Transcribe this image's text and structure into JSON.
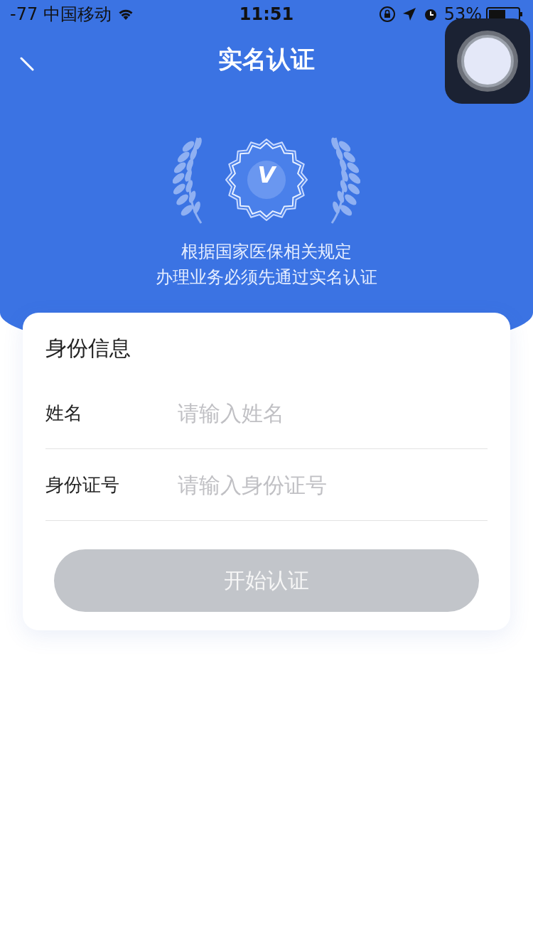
{
  "status_bar": {
    "signal": "-77",
    "carrier": "中国移动",
    "time": "11:51",
    "battery": "53%"
  },
  "nav": {
    "title": "实名认证"
  },
  "hero": {
    "badge_mark": "V",
    "notice": [
      "根据国家医保相关规定",
      "办理业务必须先通过实名认证"
    ]
  },
  "form": {
    "title": "身份信息",
    "fields": [
      {
        "label": "姓名",
        "placeholder": "请输入姓名"
      },
      {
        "label": "身份证号",
        "placeholder": "请输入身份证号"
      }
    ],
    "submit": {
      "label": "开始认证",
      "disabled": true
    }
  }
}
